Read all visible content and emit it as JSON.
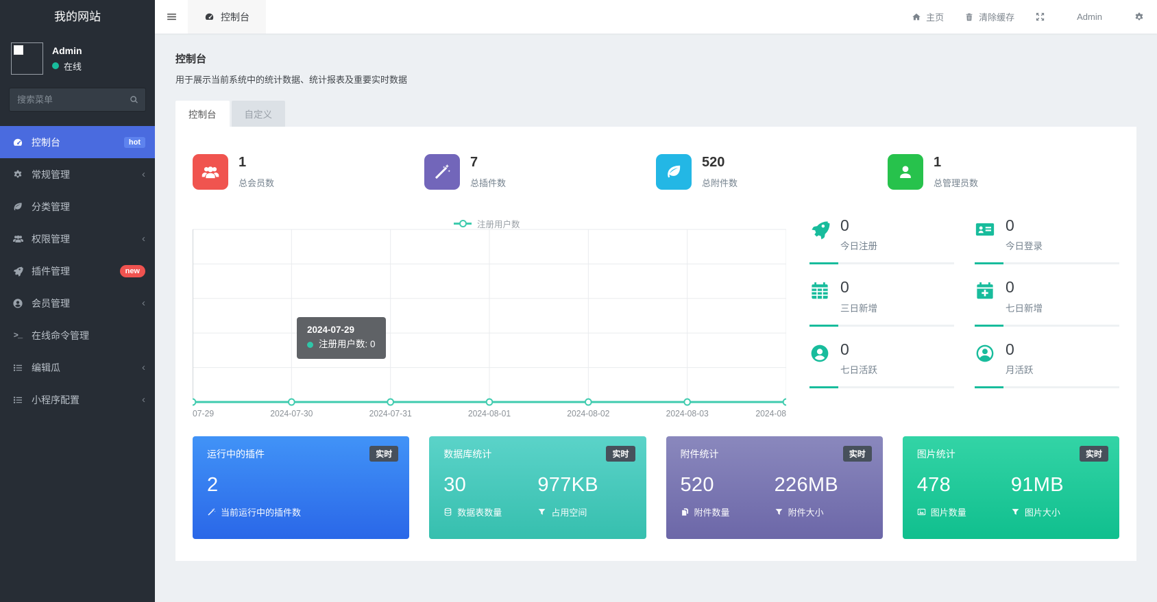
{
  "brand": "我的网站",
  "sidebar": {
    "user": {
      "name": "Admin",
      "status": "在线"
    },
    "search_placeholder": "搜索菜单",
    "menu": [
      {
        "label": "控制台",
        "badge": "hot"
      },
      {
        "label": "常规管理"
      },
      {
        "label": "分类管理"
      },
      {
        "label": "权限管理"
      },
      {
        "label": "插件管理",
        "badge": "new"
      },
      {
        "label": "会员管理"
      },
      {
        "label": "在线命令管理"
      },
      {
        "label": "编辑瓜"
      },
      {
        "label": "小程序配置"
      }
    ]
  },
  "topbar": {
    "tab": "控制台",
    "home": "主页",
    "clear_cache": "清除缓存",
    "username": "Admin"
  },
  "page": {
    "title": "控制台",
    "subtitle": "用于展示当前系统中的统计数据、统计报表及重要实时数据",
    "tabs": [
      {
        "label": "控制台"
      },
      {
        "label": "自定义"
      }
    ]
  },
  "stats": [
    {
      "value": "1",
      "label": "总会员数",
      "color": "#f0544f"
    },
    {
      "value": "7",
      "label": "总插件数",
      "color": "#7266ba"
    },
    {
      "value": "520",
      "label": "总附件数",
      "color": "#23b7e5"
    },
    {
      "value": "1",
      "label": "总管理员数",
      "color": "#27c24c"
    }
  ],
  "chart_data": {
    "type": "line",
    "x": [
      "2024-07-29",
      "2024-07-30",
      "2024-07-31",
      "2024-08-01",
      "2024-08-02",
      "2024-08-03",
      "2024-08-04"
    ],
    "x_labels": [
      "07-29",
      "2024-07-30",
      "2024-07-31",
      "2024-08-01",
      "2024-08-02",
      "2024-08-03",
      "2024-08"
    ],
    "series": [
      {
        "name": "注册用户数",
        "values": [
          0,
          0,
          0,
          0,
          0,
          0,
          0
        ]
      }
    ],
    "ylim": [
      0,
      5
    ],
    "grid": true,
    "legend_position": "top",
    "color": "#3fcbae",
    "tooltip": {
      "title": "2024-07-29",
      "label": "注册用户数",
      "value": 0,
      "text": "注册用户数: 0"
    }
  },
  "mini_stats": [
    {
      "value": "0",
      "label": "今日注册"
    },
    {
      "value": "0",
      "label": "今日登录"
    },
    {
      "value": "0",
      "label": "三日新增"
    },
    {
      "value": "0",
      "label": "七日新增"
    },
    {
      "value": "0",
      "label": "七日活跃"
    },
    {
      "value": "0",
      "label": "月活跃"
    }
  ],
  "cards": [
    {
      "title": "运行中的插件",
      "badge": "实时",
      "accent": "#2f7df2",
      "metrics": [
        {
          "value": "2",
          "label": "当前运行中的插件数"
        }
      ]
    },
    {
      "title": "数据库统计",
      "badge": "实时",
      "accent": "#43c8ba",
      "metrics": [
        {
          "value": "30",
          "label": "数据表数量"
        },
        {
          "value": "977KB",
          "label": "占用空间"
        }
      ]
    },
    {
      "title": "附件统计",
      "badge": "实时",
      "accent": "#7a76b1",
      "metrics": [
        {
          "value": "520",
          "label": "附件数量"
        },
        {
          "value": "226MB",
          "label": "附件大小"
        }
      ]
    },
    {
      "title": "图片统计",
      "badge": "实时",
      "accent": "#1fc999",
      "metrics": [
        {
          "value": "478",
          "label": "图片数量"
        },
        {
          "value": "91MB",
          "label": "图片大小"
        }
      ]
    }
  ]
}
